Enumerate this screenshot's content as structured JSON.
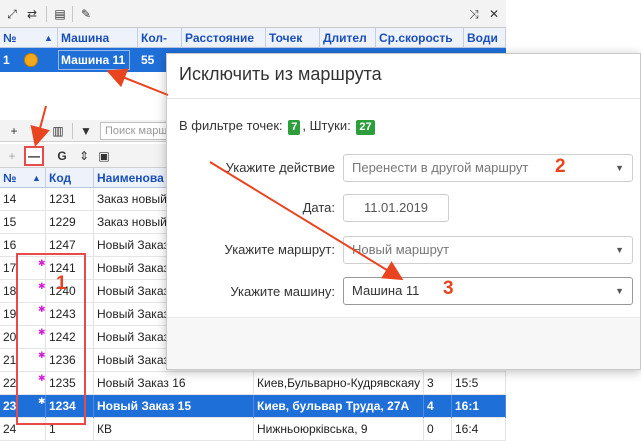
{
  "top_toolbar": {
    "icons": [
      "arrows-icon",
      "swap-icon",
      "print-icon",
      "wrench-icon",
      "shuffle-icon",
      "close-icon"
    ]
  },
  "routes_table": {
    "columns": [
      "№",
      "Машина",
      "Кол-",
      "Расстояние",
      "Точек",
      "Длител",
      "Ср.скорость",
      "Води"
    ],
    "row": {
      "num": "1",
      "machine": "Машина 11",
      "count": "55"
    }
  },
  "orders_panel": {
    "search_placeholder": "Поиск марш",
    "toolbar2_g": "G",
    "columns": [
      "№",
      "Код",
      "Наименова"
    ],
    "rows": [
      {
        "num": "14",
        "code": "1231",
        "name": "Заказ новый",
        "addr": "",
        "pts": "",
        "time": "",
        "pin": false
      },
      {
        "num": "15",
        "code": "1229",
        "name": "Заказ новый",
        "addr": "",
        "pts": "",
        "time": "",
        "pin": false
      },
      {
        "num": "16",
        "code": "1247",
        "name": "Новый Заказ",
        "addr": "",
        "pts": "",
        "time": "",
        "pin": false
      },
      {
        "num": "17",
        "code": "1241",
        "name": "Новый Заказ",
        "addr": "",
        "pts": "",
        "time": "",
        "pin": true
      },
      {
        "num": "18",
        "code": "1240",
        "name": "Новый Заказ",
        "addr": "",
        "pts": "",
        "time": "",
        "pin": true
      },
      {
        "num": "19",
        "code": "1243",
        "name": "Новый Заказ",
        "addr": "",
        "pts": "",
        "time": "",
        "pin": true
      },
      {
        "num": "20",
        "code": "1242",
        "name": "Новый Заказ",
        "addr": "",
        "pts": "",
        "time": "",
        "pin": true
      },
      {
        "num": "21",
        "code": "1236",
        "name": "Новый Заказ",
        "addr": "",
        "pts": "",
        "time": "",
        "pin": true
      },
      {
        "num": "22",
        "code": "1235",
        "name": "Новый Заказ 16",
        "addr": "Киев,Бульварно-Кудрявскаяу",
        "pts": "3",
        "time": "15:5",
        "pin": true
      },
      {
        "num": "23",
        "code": "1234",
        "name": "Новый Заказ 15",
        "addr": "Киев, бульвар Труда, 27А",
        "pts": "4",
        "time": "16:1",
        "pin": true
      },
      {
        "num": "24",
        "code": "1",
        "name": "КВ",
        "addr": "Нижньоюрківська, 9",
        "pts": "0",
        "time": "16:4",
        "pin": false
      }
    ]
  },
  "modal": {
    "title": "Исключить из маршрута",
    "filter_prefix": "В фильтре точек:",
    "filter_points": "7",
    "filter_sep": ", Штуки:",
    "filter_pieces": "27",
    "action_label": "Укажите действие",
    "action_value": "Перенести в другой маршрут",
    "date_label": "Дата:",
    "date_value": "11.01.2019",
    "route_label": "Укажите маршрут:",
    "route_value": "Новый маршрут",
    "machine_label": "Укажите машину:",
    "machine_value": "Машина 11"
  },
  "annotations": {
    "mark1": "1",
    "mark2": "2",
    "mark3": "3"
  },
  "colors": {
    "accent": "#1f6fd8",
    "badge": "#2e9e3c",
    "annotation": "#e8441f"
  }
}
